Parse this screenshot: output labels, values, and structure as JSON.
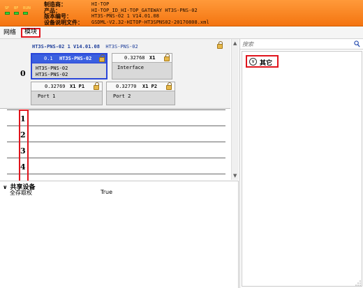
{
  "header": {
    "labels": [
      "制造商：",
      "产品：",
      "版本编号：",
      "设备说明文件："
    ],
    "values": [
      "HI-TOP",
      "HI-TOP_ID_HI-TOP_GATEWAY HT3S-PNS-02",
      "HT3S-PNS-02 1 V14.01.08",
      "GSDML-V2.32-HITOP-HT3SPNS02-20170808.xml"
    ],
    "logo_labels": [
      "SF",
      "BF",
      "RUN"
    ]
  },
  "tabs": {
    "network": "网络",
    "module": "模块"
  },
  "module": {
    "slot0_index": "0",
    "title_bold": "HT3S-PNS-02 1 V14.01.08",
    "title_name": "HT3S-PNS-02",
    "card_main": {
      "addr": "0.1",
      "name": "HT3S-PNS-02",
      "line1": "HT3S-PNS-02",
      "line2": "HT3S-PNS-02"
    },
    "card_interface": {
      "addr": "0.32768",
      "tag": "X1",
      "name": "Interface"
    },
    "card_port1": {
      "addr": "0.32769",
      "tag": "X1 P1",
      "name": "Port 1"
    },
    "card_port2": {
      "addr": "0.32770",
      "tag": "X1 P2",
      "name": "Port 2"
    },
    "slot_rows": [
      "1",
      "2",
      "3",
      "4"
    ]
  },
  "shared": {
    "title": "共享设备",
    "prop_name": "全存取权",
    "prop_value": "True"
  },
  "catalog": {
    "search_placeholder": "搜索",
    "group_label": "其它"
  },
  "colors": {
    "header_orange": "#f47410",
    "selection_blue": "#3a5fe0",
    "highlight_red": "#e0141c",
    "title_blue": "#1d3d9a"
  }
}
